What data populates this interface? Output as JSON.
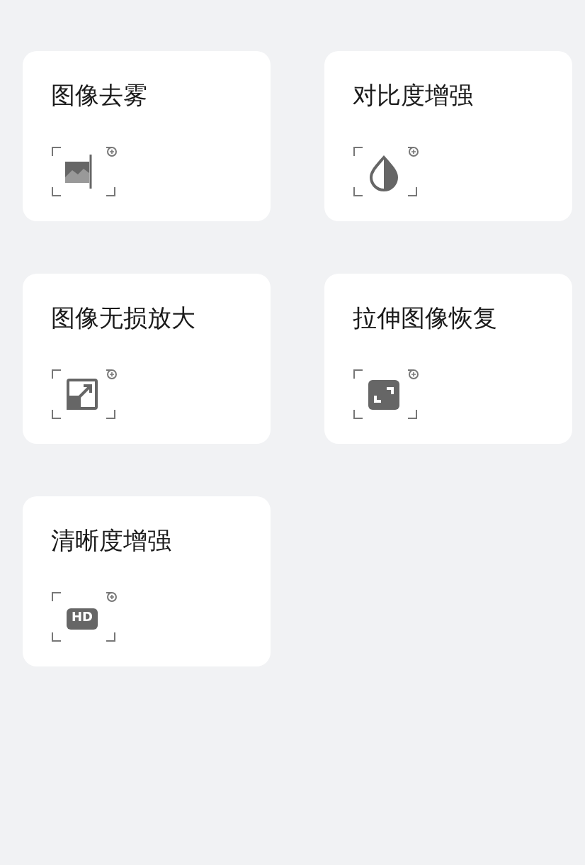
{
  "tools": [
    {
      "title": "图像去雾",
      "kind": "dehaze"
    },
    {
      "title": "对比度增强",
      "kind": "contrast"
    },
    {
      "title": "图像无损放大",
      "kind": "upscale"
    },
    {
      "title": "拉伸图像恢复",
      "kind": "stretch"
    },
    {
      "title": "清晰度增强",
      "kind": "hd",
      "icon_text": "HD"
    }
  ]
}
